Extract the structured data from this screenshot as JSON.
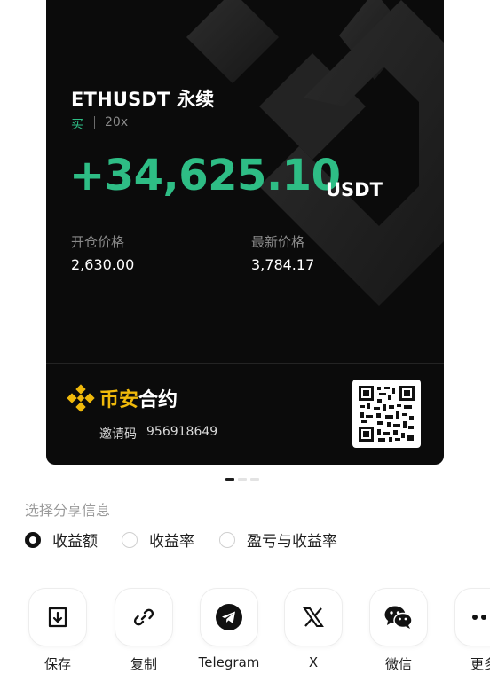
{
  "card": {
    "symbol": "ETHUSDT 永续",
    "side": "买",
    "leverage": "20x",
    "pnl": "+34,625.10",
    "pnl_unit": "USDT",
    "entry_label": "开仓价格",
    "entry_price": "2,630.00",
    "last_label": "最新价格",
    "last_price": "3,784.17",
    "brand_part1": "币安",
    "brand_part2": "合约",
    "referral_label": "邀请码",
    "referral_code": "956918649",
    "accent_color": "#2ebd85",
    "brand_color": "#f0b90b"
  },
  "pager": {
    "pages": 3,
    "active": 0
  },
  "share_options": {
    "title": "选择分享信息",
    "options": [
      {
        "label": "收益额",
        "selected": true
      },
      {
        "label": "收益率",
        "selected": false
      },
      {
        "label": "盈亏与收益率",
        "selected": false
      }
    ]
  },
  "share_targets": [
    {
      "label": "保存",
      "icon": "save-icon"
    },
    {
      "label": "复制",
      "icon": "link-icon"
    },
    {
      "label": "Telegram",
      "icon": "telegram-icon"
    },
    {
      "label": "X",
      "icon": "x-icon"
    },
    {
      "label": "微信",
      "icon": "wechat-icon"
    },
    {
      "label": "更多",
      "icon": "more-icon"
    }
  ]
}
